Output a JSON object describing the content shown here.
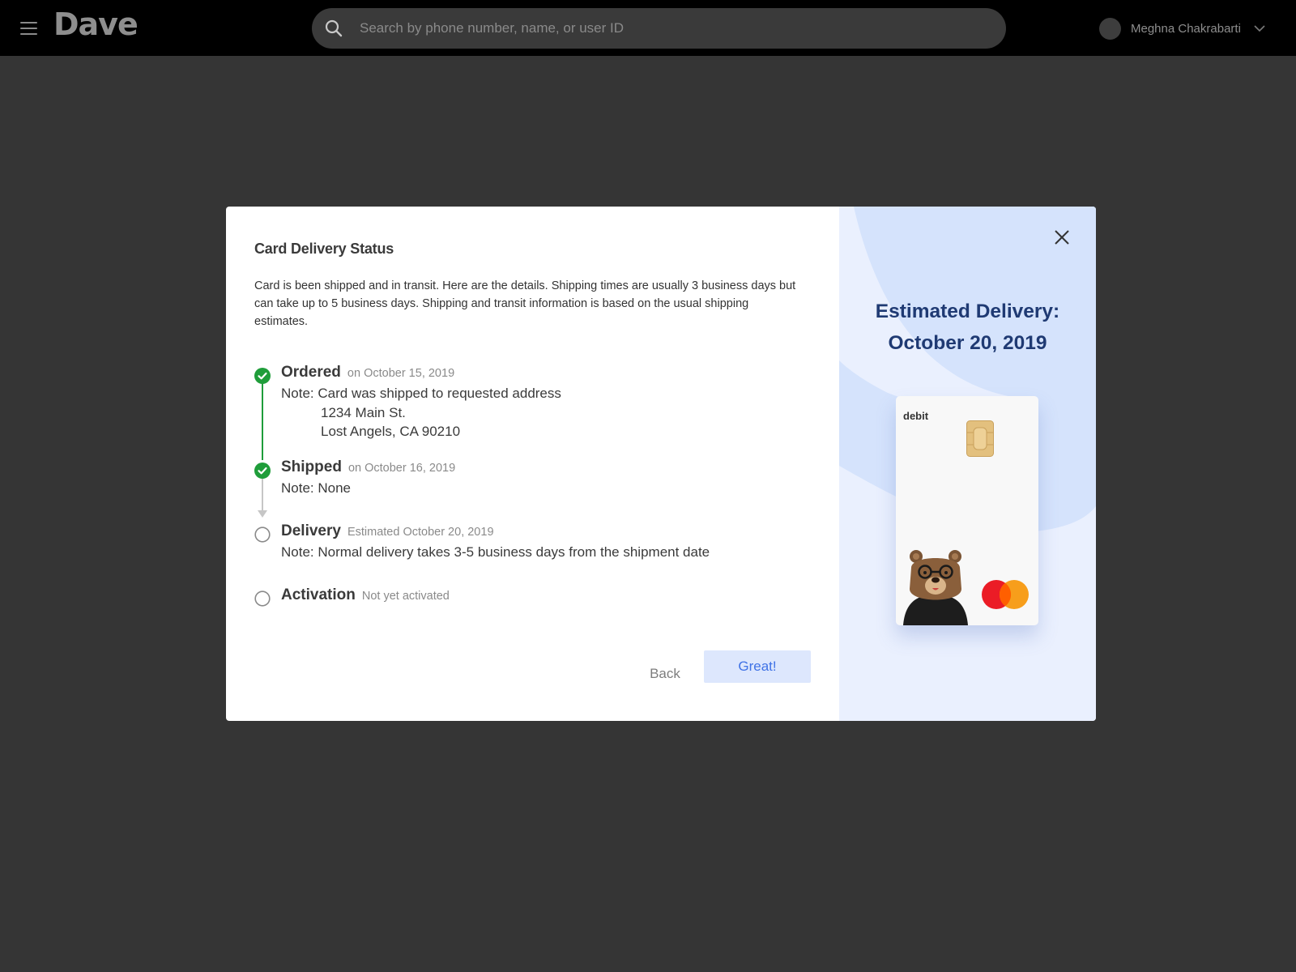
{
  "header": {
    "logo": "Dave",
    "search_placeholder": "Search by phone number, name, or user ID",
    "user_name": "Meghna Chakrabarti"
  },
  "modal": {
    "title": "Card Delivery Status",
    "description": "Card is been shipped and in transit. Here are the details. Shipping times are usually 3 business days but can take up to 5 business days. Shipping and transit information is based on the usual shipping estimates.",
    "steps": [
      {
        "label": "Ordered",
        "date": "on October 15, 2019",
        "status": "complete",
        "note_prefix": "Note:",
        "note": "Card was shipped to requested address",
        "address_line1": "1234 Main St.",
        "address_line2": "Lost Angels, CA 90210"
      },
      {
        "label": "Shipped",
        "date": "on October 16, 2019",
        "status": "complete",
        "note": "Note: None"
      },
      {
        "label": "Delivery",
        "date": "Estimated October 20, 2019",
        "status": "pending",
        "note": "Note: Normal delivery takes 3-5 business days from the shipment date"
      },
      {
        "label": "Activation",
        "date": "Not yet activated",
        "status": "pending"
      }
    ],
    "back_label": "Back",
    "confirm_label": "Great!",
    "estimate_line1": "Estimated Delivery:",
    "estimate_line2": "October 20, 2019",
    "card_type_label": "debit"
  },
  "colors": {
    "complete": "#1f9d3a",
    "pending": "#8a8a8a",
    "accent": "#3f72e6",
    "estimate_text": "#1f3a73",
    "panel_bg": "#eaf0fe"
  },
  "icons": [
    "hamburger-menu-icon",
    "search-icon",
    "chevron-down-icon",
    "check-circle-icon",
    "empty-circle-icon",
    "close-icon",
    "card-chip-icon",
    "mastercard-logo",
    "bear-mascot"
  ]
}
